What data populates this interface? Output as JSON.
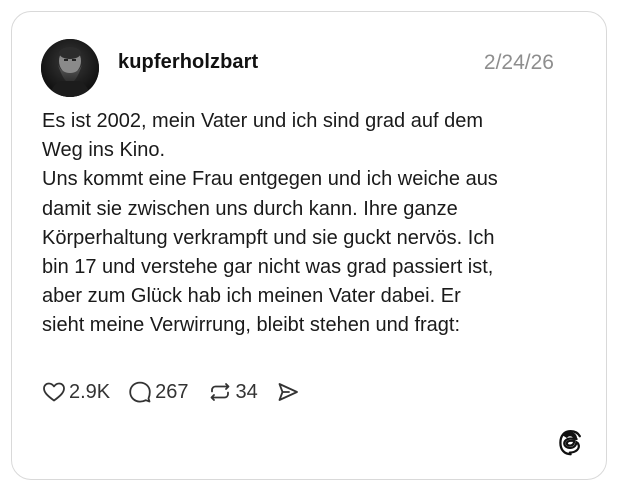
{
  "post": {
    "username": "kupferholzbart",
    "date": "2/24/26",
    "text": "Es ist 2002, mein Vater und ich sind grad auf dem\nWeg ins Kino.\nUns kommt eine Frau entgegen und ich weiche aus\ndamit sie zwischen uns durch kann. Ihre ganze\nKörperhaltung verkrampft und sie guckt nervös. Ich\nbin 17 und verstehe gar nicht was grad passiert ist,\naber zum Glück hab ich meinen Vater dabei. Er\nsieht meine Verwirrung, bleibt stehen und fragt:",
    "actions": {
      "likes": "2.9K",
      "replies": "267",
      "reposts": "34"
    }
  },
  "icons": {
    "like": "heart-icon",
    "reply": "speech-bubble-icon",
    "repost": "repost-icon",
    "share": "send-icon",
    "brand": "threads-logo"
  }
}
